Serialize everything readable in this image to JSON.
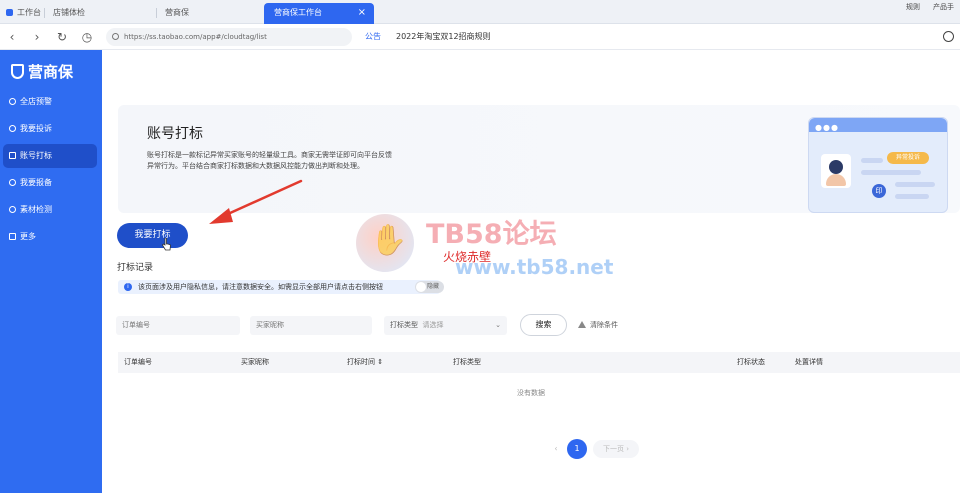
{
  "tabs": [
    {
      "label": "工作台"
    },
    {
      "label": "店铺体检"
    },
    {
      "label": "营商保"
    },
    {
      "label": "营商保工作台",
      "active": true
    }
  ],
  "top_right": {
    "rules": "规则",
    "product": "产品手"
  },
  "address": {
    "url": "https://ss.taobao.com/app#/cloudtag/list",
    "notice_label": "公告",
    "notice_text": "2022年淘宝双12招商规则"
  },
  "sidebar": {
    "brand": "营商保",
    "items": [
      {
        "label": "全店预警"
      },
      {
        "label": "我要投诉"
      },
      {
        "label": "账号打标",
        "active": true
      },
      {
        "label": "我要报备"
      },
      {
        "label": "素材检测"
      },
      {
        "label": "更多"
      }
    ]
  },
  "hero": {
    "title": "账号打标",
    "desc_line1": "账号打标是一款标记异常买家账号的轻量级工具。商家无需举证即可向平台反馈",
    "desc_line2": "异常行为。平台结合商家打标数据和大数据风控能力做出判断和处理。",
    "illus_tag": "异常投诉"
  },
  "actions": {
    "cta": "我要打标"
  },
  "records": {
    "title": "打标记录",
    "tip": "该页面涉及用户隐私信息，请注意数据安全。如需显示全部用户请点击右侧按钮",
    "toggle": "隐藏"
  },
  "filters": {
    "order_placeholder": "订单编号",
    "buyer_placeholder": "买家昵称",
    "type_label": "打标类型",
    "type_placeholder": "请选择",
    "search": "搜索",
    "clear": "清除条件"
  },
  "table": {
    "columns": [
      "订单编号",
      "买家昵称",
      "打标时间",
      "打标类型",
      "打标状态",
      "处置详情"
    ],
    "empty": "没有数据"
  },
  "pagination": {
    "current": "1",
    "next": "下一页"
  },
  "colors": {
    "primary": "#2e67f0",
    "sidebar": "#2f6cf1",
    "active": "#1f4fc9",
    "annotation": "#e23a2e"
  },
  "watermark": {
    "title": "TB58论坛",
    "subtitle": "火烧赤壁",
    "url": "www.tb58.net"
  }
}
